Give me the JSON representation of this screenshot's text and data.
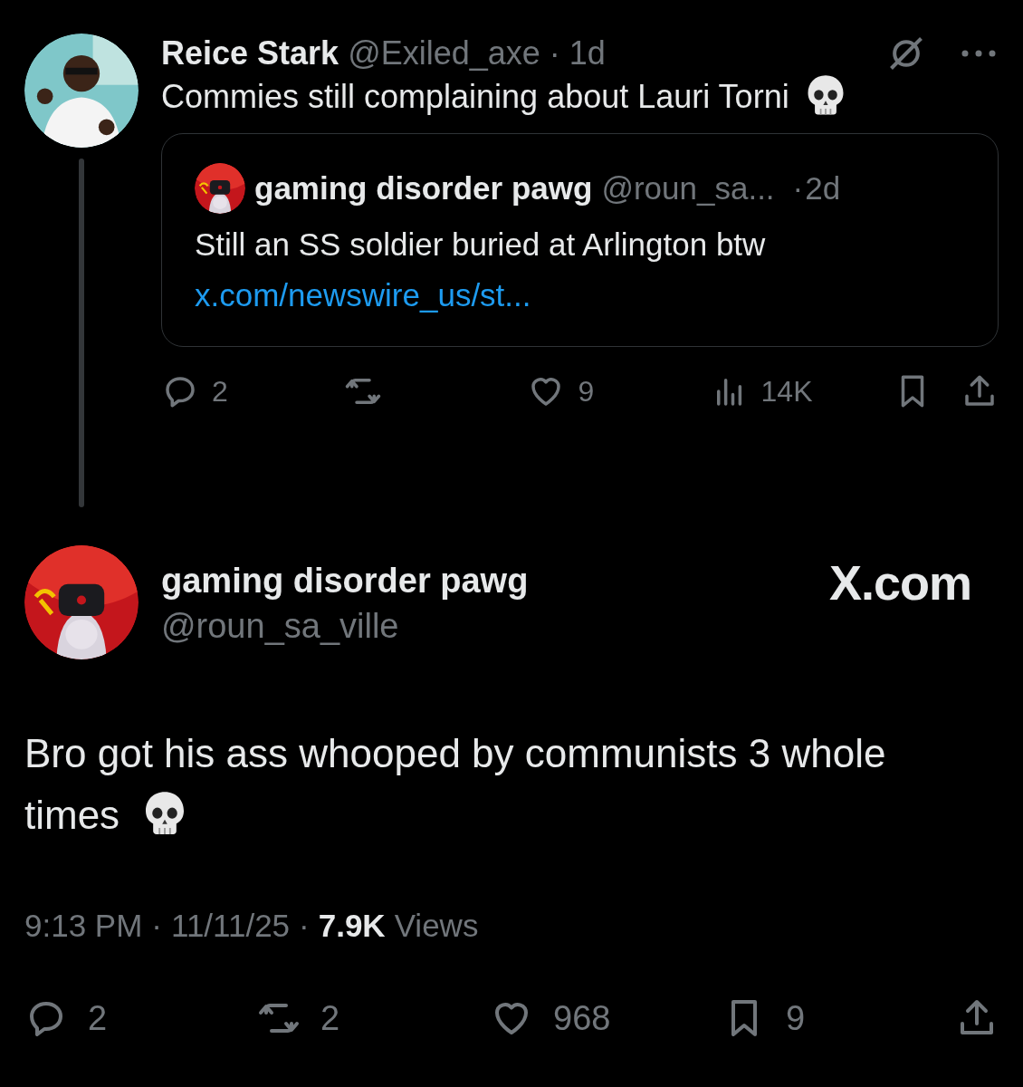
{
  "parent_post": {
    "author_name": "Reice Stark",
    "handle": "@Exiled_axe",
    "separator": "·",
    "age": "1d",
    "text": "Commies still complaining about Lauri Torni",
    "quote": {
      "author_name": "gaming disorder pawg",
      "handle": "@roun_sa...",
      "separator": "·",
      "age": "2d",
      "text": "Still an SS soldier buried at Arlington btw",
      "link": "x.com/newswire_us/st..."
    },
    "actions": [
      {
        "kind": "reply",
        "count": "2"
      },
      {
        "kind": "repost"
      },
      {
        "kind": "like",
        "count": "9"
      },
      {
        "kind": "views",
        "count": "14K"
      },
      {
        "kind": "bookmark"
      },
      {
        "kind": "share"
      }
    ]
  },
  "main_post": {
    "author_name": "gaming disorder pawg",
    "handle": "@roun_sa_ville",
    "brand": "X.com",
    "text_line_1": "Bro got his ass whooped by communists 3 whole",
    "text_line_2": "times",
    "time": "9:13 PM",
    "separator_1": "·",
    "date": "11/11/25",
    "separator_2": "·",
    "views_count": "7.9K",
    "views_label": "Views",
    "actions": [
      {
        "kind": "reply",
        "count": "2"
      },
      {
        "kind": "repost",
        "count": "2"
      },
      {
        "kind": "like",
        "count": "968"
      },
      {
        "kind": "bookmark",
        "count": "9"
      },
      {
        "kind": "share"
      }
    ]
  }
}
